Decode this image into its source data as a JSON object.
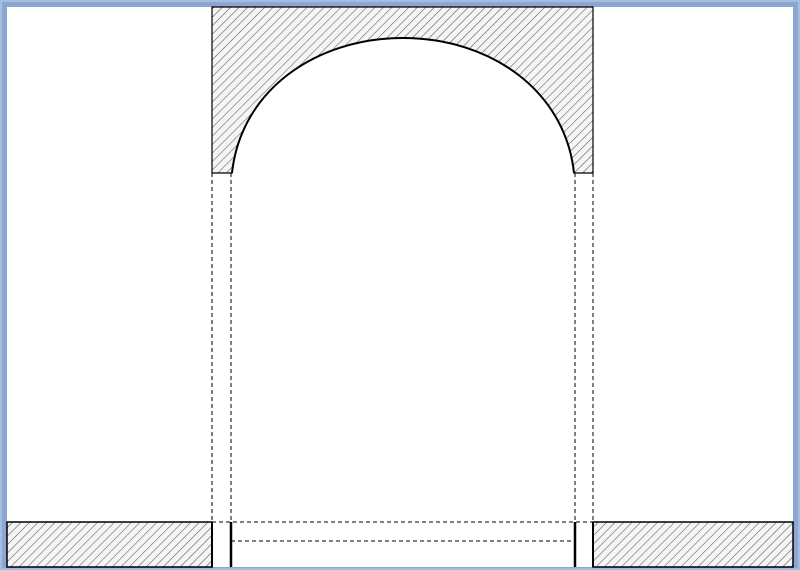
{
  "window": {
    "frame_color": "#8aa7d0",
    "frame_highlight": "#c3d4ea",
    "canvas_color": "#ffffff"
  },
  "drawing": {
    "line_color": "#000000",
    "hatch_color": "#555555",
    "hatch_fill": "#f5f5f5",
    "hatch_pattern": "diagonal-lines",
    "hidden_line_style": "dashed",
    "elements": [
      "arch-head-section",
      "arch-curve",
      "left-jamb-hidden-lines",
      "right-jamb-hidden-lines",
      "left-wall-section",
      "right-wall-section",
      "threshold-hidden-lines"
    ]
  }
}
